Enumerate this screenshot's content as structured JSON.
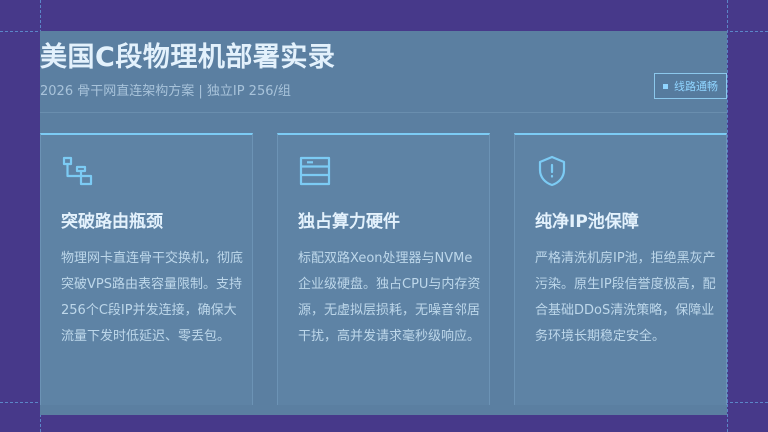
{
  "header": {
    "title": "美国C段物理机部署实录",
    "subtitle": "2026 骨干网直连架构方案 | 独立IP 256/组",
    "badge": "线路通畅"
  },
  "cards": [
    {
      "icon": "route-icon",
      "title": "突破路由瓶颈",
      "desc": "物理网卡直连骨干交换机，彻底突破VPS路由表容量限制。支持256个C段IP并发连接，确保大流量下发时低延迟、零丢包。"
    },
    {
      "icon": "server-icon",
      "title": "独占算力硬件",
      "desc": "标配双路Xeon处理器与NVMe企业级硬盘。独占CPU与内存资源，无虚拟层损耗，无噪音邻居干扰，高并发请求毫秒级响应。"
    },
    {
      "icon": "shield-icon",
      "title": "纯净IP池保障",
      "desc": "严格清洗机房IP池，拒绝黑灰产污染。原生IP段信誉度极高，配合基础DDoS清洗策略，保障业务环境长期稳定安全。"
    }
  ],
  "colors": {
    "background": "#47398a",
    "panel": "#5b7fa1",
    "accent": "#7ccbf4",
    "text": "#e3f1fc"
  }
}
